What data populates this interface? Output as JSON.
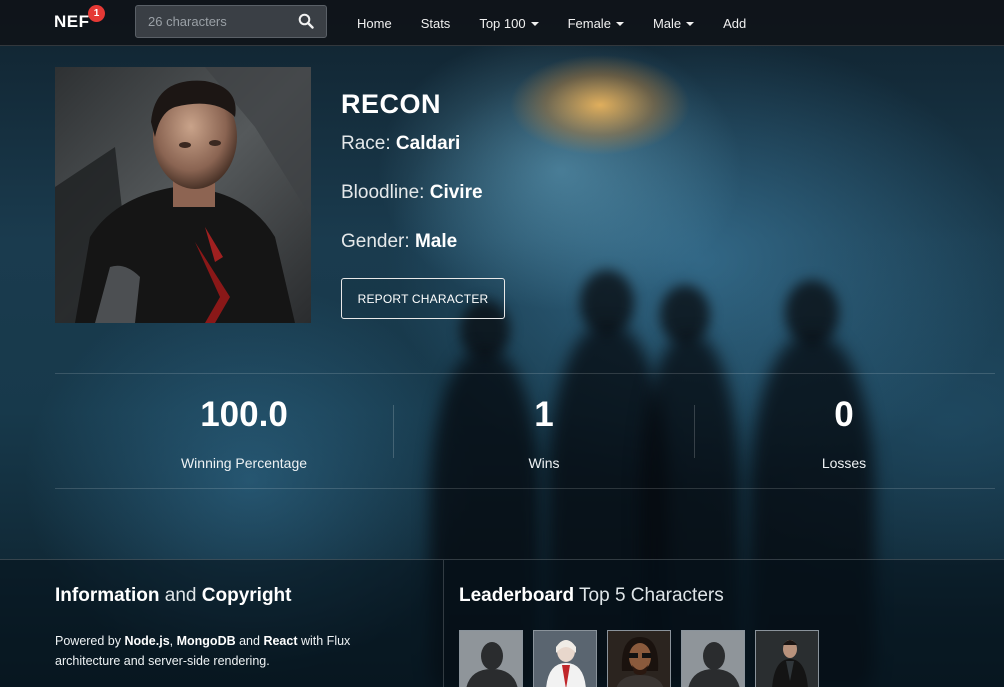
{
  "navbar": {
    "brand": "NEF",
    "badge_count": "1",
    "search_placeholder": "26 characters",
    "links": [
      {
        "label": "Home",
        "dropdown": false
      },
      {
        "label": "Stats",
        "dropdown": false
      },
      {
        "label": "Top 100",
        "dropdown": true
      },
      {
        "label": "Female",
        "dropdown": true
      },
      {
        "label": "Male",
        "dropdown": true
      },
      {
        "label": "Add",
        "dropdown": false
      }
    ]
  },
  "character": {
    "name": "RECON",
    "race_label": "Race:",
    "race": "Caldari",
    "bloodline_label": "Bloodline:",
    "bloodline": "Civire",
    "gender_label": "Gender:",
    "gender": "Male",
    "report_button": "REPORT CHARACTER"
  },
  "stats": [
    {
      "value": "100.0",
      "label": "Winning Percentage"
    },
    {
      "value": "1",
      "label": "Wins"
    },
    {
      "value": "0",
      "label": "Losses"
    }
  ],
  "footer": {
    "info_title_bold1": "Information",
    "info_title_and": "and",
    "info_title_bold2": "Copyright",
    "powered_by": "Powered by",
    "tech1": "Node.js",
    "tech2": "MongoDB",
    "and_word": "and",
    "tech3": "React",
    "rest": "with Flux architecture and server-side rendering.",
    "leaderboard_bold": "Leaderboard",
    "leaderboard_light": "Top 5 Characters",
    "thumbnails": [
      "silhouette",
      "white-suit-female",
      "glasses-male",
      "silhouette",
      "dark-suit-male"
    ]
  },
  "colors": {
    "badge": "#e53935",
    "navbar_bg": "#0f1419",
    "accent_glow": "#f0a040"
  }
}
